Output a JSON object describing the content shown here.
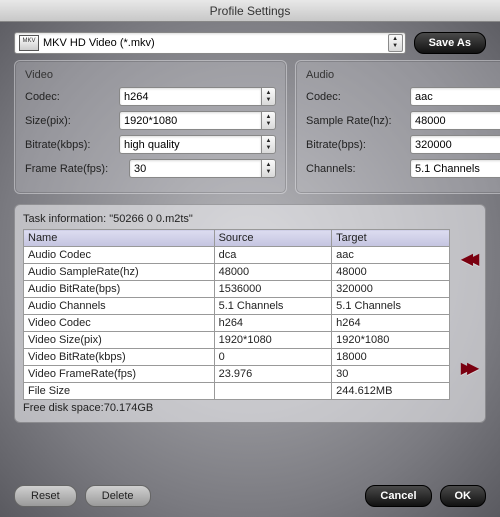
{
  "window": {
    "title": "Profile Settings"
  },
  "profile": {
    "icon_label": "MKV",
    "selected": "MKV HD Video (*.mkv)",
    "save_as": "Save As"
  },
  "video": {
    "heading": "Video",
    "codec_label": "Codec:",
    "codec_value": "h264",
    "size_label": "Size(pix):",
    "size_value": "1920*1080",
    "bitrate_label": "Bitrate(kbps):",
    "bitrate_value": "high quality",
    "fps_label": "Frame Rate(fps):",
    "fps_value": "30"
  },
  "audio": {
    "heading": "Audio",
    "codec_label": "Codec:",
    "codec_value": "aac",
    "samplerate_label": "Sample Rate(hz):",
    "samplerate_value": "48000",
    "bitrate_label": "Bitrate(bps):",
    "bitrate_value": "320000",
    "channels_label": "Channels:",
    "channels_value": "5.1 Channels"
  },
  "task": {
    "caption": "Task information: \"50266 0 0.m2ts\"",
    "headers": {
      "name": "Name",
      "source": "Source",
      "target": "Target"
    },
    "rows": [
      {
        "name": "Audio Codec",
        "source": "dca",
        "target": "aac"
      },
      {
        "name": "Audio SampleRate(hz)",
        "source": "48000",
        "target": "48000"
      },
      {
        "name": "Audio BitRate(bps)",
        "source": "1536000",
        "target": "320000"
      },
      {
        "name": "Audio Channels",
        "source": "5.1 Channels",
        "target": "5.1 Channels"
      },
      {
        "name": "Video Codec",
        "source": "h264",
        "target": "h264"
      },
      {
        "name": "Video Size(pix)",
        "source": "1920*1080",
        "target": "1920*1080"
      },
      {
        "name": "Video BitRate(kbps)",
        "source": "0",
        "target": "18000"
      },
      {
        "name": "Video FrameRate(fps)",
        "source": "23.976",
        "target": "30"
      },
      {
        "name": "File Size",
        "source": "",
        "target": "244.612MB"
      }
    ],
    "free_space": "Free disk space:70.174GB"
  },
  "buttons": {
    "reset": "Reset",
    "delete": "Delete",
    "cancel": "Cancel",
    "ok": "OK"
  }
}
